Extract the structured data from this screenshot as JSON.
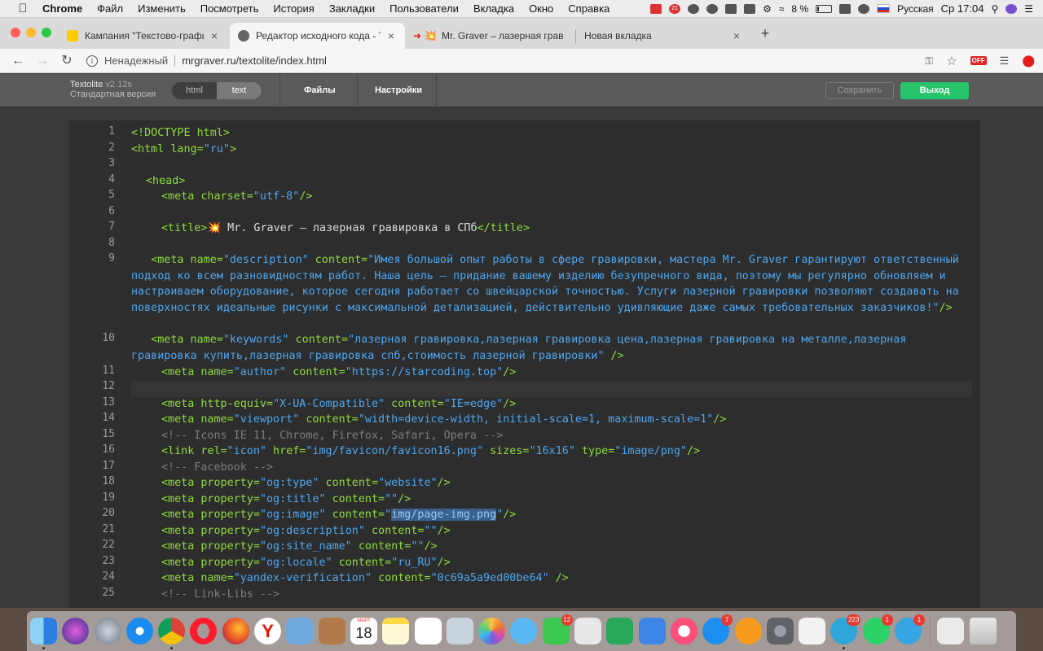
{
  "menubar": {
    "app": "Chrome",
    "items": [
      "Файл",
      "Изменить",
      "Посмотреть",
      "История",
      "Закладки",
      "Пользователи",
      "Вкладка",
      "Окно",
      "Справка"
    ],
    "status": {
      "mail_badge": "21",
      "battery": "8 %",
      "input_language": "Русская",
      "clock": "Ср 17:04"
    }
  },
  "tabs": [
    {
      "title": "Кампания \"Текстово-графиче",
      "active": false
    },
    {
      "title": "Редактор исходного кода - Te",
      "active": true
    },
    {
      "title": "Mr. Graver – лазерная грав",
      "active": false
    },
    {
      "title": "Новая вкладка",
      "active": false
    }
  ],
  "omnibox": {
    "security": "Ненадежный",
    "url": "mrgraver.ru/textolite/index.html"
  },
  "extension_badge": "OFF",
  "app": {
    "name": "Textolite",
    "version": "v2.12s",
    "edition": "Стандартная версия",
    "modes": [
      "html",
      "text"
    ],
    "active_mode": "text",
    "nav": [
      "Файлы",
      "Настройки"
    ],
    "save_label": "Сохранить",
    "exit_label": "Выход"
  },
  "editor": {
    "line_numbers": [
      "1",
      "2",
      "3",
      "4",
      "5",
      "6",
      "7",
      "8",
      "9",
      "10",
      "11",
      "12",
      "13",
      "14",
      "15",
      "16",
      "17",
      "18",
      "19",
      "20",
      "21",
      "22",
      "23",
      "24",
      "25"
    ],
    "code": {
      "l1": "<!DOCTYPE html>",
      "l2_tag": "<html",
      "l2_attr": " lang=",
      "l2_str": "\"ru\"",
      "l2_close": ">",
      "l4": "<head>",
      "l5_tag": "<meta",
      "l5_attr": " charset=",
      "l5_str": "\"utf-8\"",
      "l5_close": "/>",
      "l7_open": "<title>",
      "l7_text": "💥 Mr. Graver – лазерная гравировка в СПб",
      "l7_close": "</title>",
      "l9_tag": "<meta",
      "l9_attr1": " name=",
      "l9_str1": "\"description\"",
      "l9_attr2": " content=",
      "l9_str2": "\"Имея большой опыт работы в сфере гравировки, мастера Mr. Graver гарантируют ответственный подход ко всем разновидностям работ. Наша цель – придание вашему изделию безупречного вида, поэтому мы регулярно обновляем и настраиваем оборудование, которое сегодня работает со швейцарской точностью. Услуги лазерной гравировки позволяют создавать на поверхностях идеальные рисунки с максимальной детализацией, действительно удивляющие даже самых требовательных заказчиков!\"",
      "l9_close": "/>",
      "l10_tag": "<meta",
      "l10_attr1": " name=",
      "l10_str1": "\"keywords\"",
      "l10_attr2": " content=",
      "l10_str2": "\"лазерная гравировка,лазерная гравировка цена,лазерная гравировка на металле,лазерная гравировка купить,лазерная гравировка спб,стоимость лазерной гравировки\"",
      "l10_close": " />",
      "l11_tag": "<meta",
      "l11_attr1": " name=",
      "l11_str1": "\"author\"",
      "l11_attr2": " content=",
      "l11_str2": "\"https://starcoding.top\"",
      "l11_close": "/>",
      "l13_tag": "<meta",
      "l13_attr1": " http-equiv=",
      "l13_str1": "\"X-UA-Compatible\"",
      "l13_attr2": " content=",
      "l13_str2": "\"IE=edge\"",
      "l13_close": "/>",
      "l14_tag": "<meta",
      "l14_attr1": " name=",
      "l14_str1": "\"viewport\"",
      "l14_attr2": " content=",
      "l14_str2": "\"width=device-width, initial-scale=1, maximum-scale=1\"",
      "l14_close": "/>",
      "l15": "<!-- Icons IE 11, Chrome, Firefox, Safari, Opera -->",
      "l16_tag": "<link",
      "l16_attr1": " rel=",
      "l16_str1": "\"icon\"",
      "l16_attr2": " href=",
      "l16_str2": "\"img/favicon/favicon16.png\"",
      "l16_attr3": " sizes=",
      "l16_str3": "\"16x16\"",
      "l16_attr4": " type=",
      "l16_str4": "\"image/png\"",
      "l16_close": "/>",
      "l17": "<!-- Facebook -->",
      "l18_tag": "<meta",
      "l18_attr1": " property=",
      "l18_str1": "\"og:type\"",
      "l18_attr2": " content=",
      "l18_str2": "\"website\"",
      "l18_close": "/>",
      "l19_tag": "<meta",
      "l19_attr1": " property=",
      "l19_str1": "\"og:title\"",
      "l19_attr2": " content=",
      "l19_str2": "\"\"",
      "l19_close": "/>",
      "l20_tag": "<meta",
      "l20_attr1": " property=",
      "l20_str1": "\"og:image\"",
      "l20_attr2": " content=",
      "l20_q1": "\"",
      "l20_sel": "img/page-img.png",
      "l20_q2": "\"",
      "l20_close": "/>",
      "l21_tag": "<meta",
      "l21_attr1": " property=",
      "l21_str1": "\"og:description\"",
      "l21_attr2": " content=",
      "l21_str2": "\"\"",
      "l21_close": "/>",
      "l22_tag": "<meta",
      "l22_attr1": " property=",
      "l22_str1": "\"og:site_name\"",
      "l22_attr2": " content=",
      "l22_str2": "\"\"",
      "l22_close": "/>",
      "l23_tag": "<meta",
      "l23_attr1": " property=",
      "l23_str1": "\"og:locale\"",
      "l23_attr2": " content=",
      "l23_str2": "\"ru_RU\"",
      "l23_close": "/>",
      "l24_tag": "<meta",
      "l24_attr1": " name=",
      "l24_str1": "\"yandex-verification\"",
      "l24_attr2": " content=",
      "l24_str2": "\"0c69a5a9ed00be64\"",
      "l24_close": " />",
      "l25": "<!-- Link-Libs -->"
    }
  },
  "dock": {
    "calendar_day": "18",
    "calendar_month": "МАРТ",
    "badges": {
      "facetime": "12",
      "news": "7",
      "telegram": "223",
      "whatsapp": "1",
      "telegram2": "1"
    }
  },
  "colors": {
    "tag": "#8fdc3f",
    "string": "#4ea7f0",
    "comment": "#7d7d7d",
    "exit_button": "#27c469",
    "editor_bg": "#2d2d2d"
  }
}
